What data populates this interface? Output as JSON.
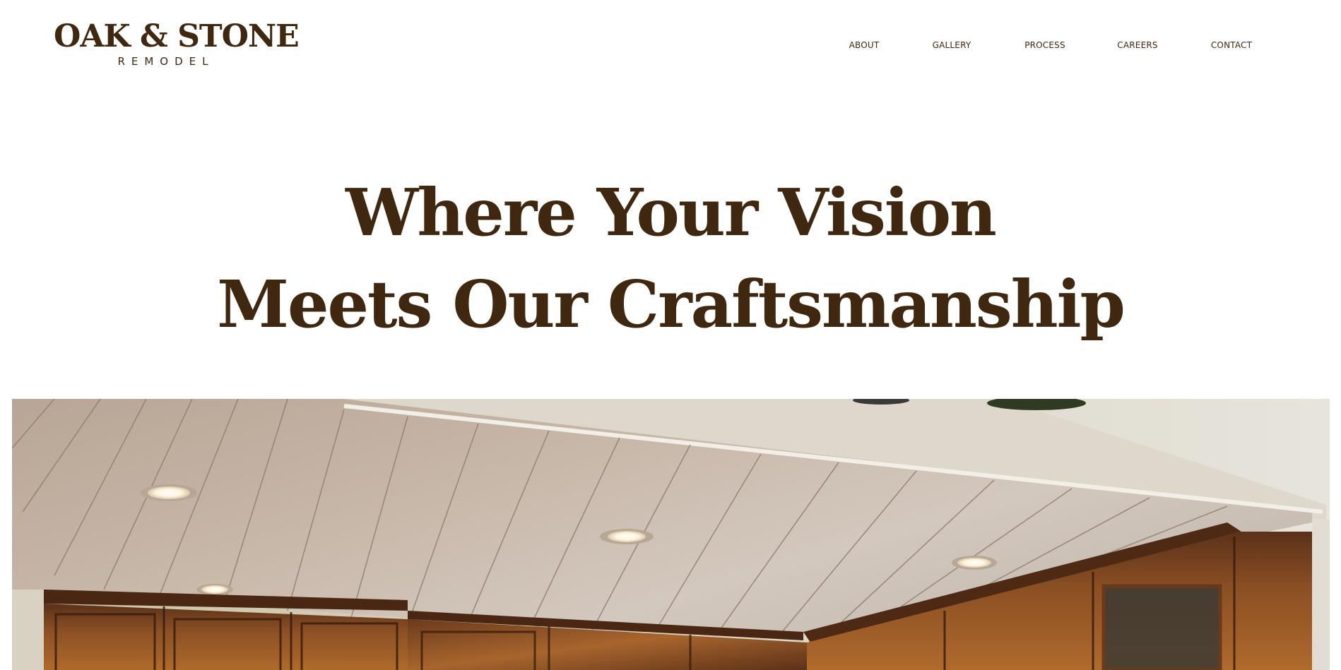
{
  "brand": {
    "name_primary": "OAK & STONE",
    "name_secondary": "REMODEL",
    "color": "#40270f"
  },
  "nav": {
    "items": [
      {
        "label": "ABOUT"
      },
      {
        "label": "GALLERY"
      },
      {
        "label": "PROCESS"
      },
      {
        "label": "CAREERS"
      },
      {
        "label": "CONTACT"
      }
    ]
  },
  "hero": {
    "heading_line_1": "Where Your Vision",
    "heading_line_2": "Meets Our Craftsmanship",
    "heading_color": "#40270f",
    "image": {
      "subject": "kitchen-cabinetry-photo",
      "colors": {
        "ceiling": "#c8b9ab",
        "wall": "#dcd8cc",
        "wood": "#7a4420",
        "light": "#fff7e6"
      }
    }
  }
}
